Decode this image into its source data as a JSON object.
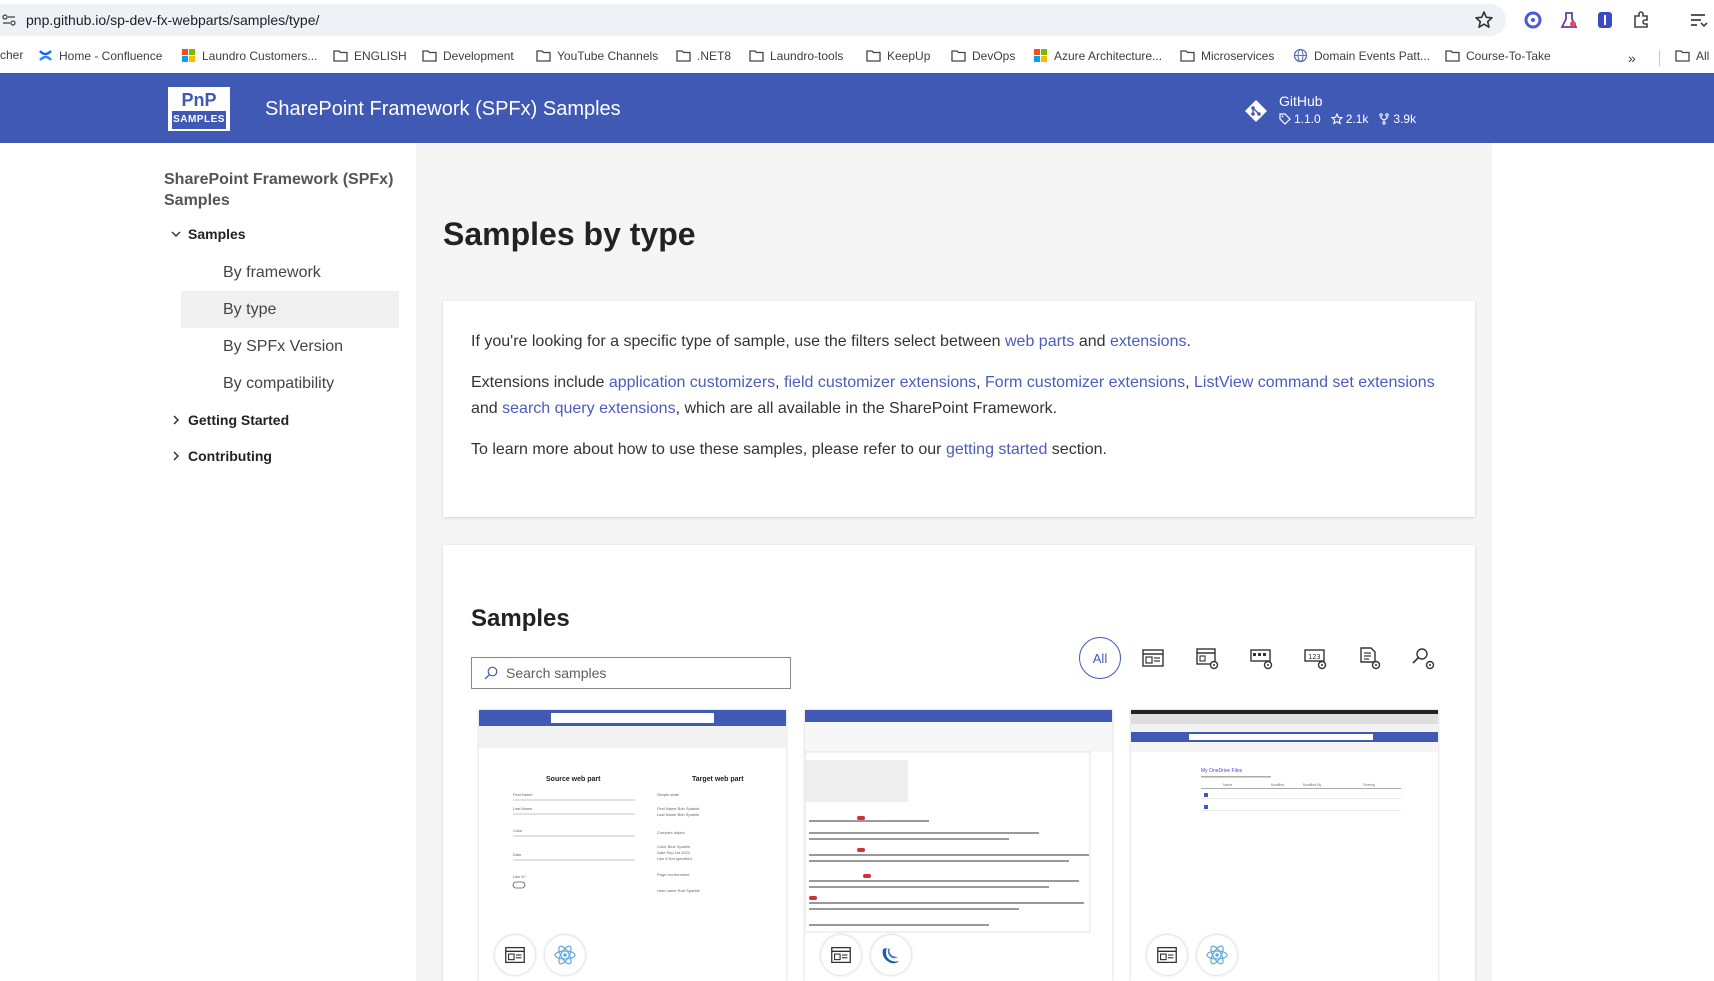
{
  "browser": {
    "url": "pnp.github.io/sp-dev-fx-webparts/samples/type/",
    "bookmarks": [
      {
        "label": "cher",
        "icon": "none"
      },
      {
        "label": "Home - Confluence",
        "icon": "confluence-icon"
      },
      {
        "label": "Laundro Customers...",
        "icon": "microsoft-icon"
      },
      {
        "label": "ENGLISH",
        "icon": "folder-icon"
      },
      {
        "label": "Development",
        "icon": "folder-icon"
      },
      {
        "label": "YouTube Channels",
        "icon": "folder-icon"
      },
      {
        "label": ".NET8",
        "icon": "folder-icon"
      },
      {
        "label": "Laundro-tools",
        "icon": "folder-icon"
      },
      {
        "label": "KeepUp",
        "icon": "folder-icon"
      },
      {
        "label": "DevOps",
        "icon": "folder-icon"
      },
      {
        "label": "Azure Architecture...",
        "icon": "microsoft-icon"
      },
      {
        "label": "Microservices",
        "icon": "folder-icon"
      },
      {
        "label": "Domain Events Patt...",
        "icon": "globe-icon"
      },
      {
        "label": "Course-To-Take",
        "icon": "folder-icon"
      }
    ],
    "more_label": "»",
    "all_bookmarks_label": "All"
  },
  "header": {
    "logo_top": "PnP",
    "logo_bottom": "SAMPLES",
    "title": "SharePoint Framework (SPFx) Samples",
    "github_label": "GitHub",
    "github_version": "1.1.0",
    "github_stars": "2.1k",
    "github_forks": "3.9k",
    "brand_color": "#4059b5"
  },
  "sidebar": {
    "title": "SharePoint Framework (SPFx) Samples",
    "samples_label": "Samples",
    "links": [
      "By framework",
      "By type",
      "By SPFx Version",
      "By compatibility"
    ],
    "active_link": "By type",
    "getting_started_label": "Getting Started",
    "contributing_label": "Contributing"
  },
  "main": {
    "title": "Samples by type",
    "intro": {
      "p1_before": "If you're looking for a specific type of sample, use the filters select between ",
      "p1_link1": "web parts",
      "p1_mid": " and ",
      "p1_link2": "extensions",
      "p1_after": ".",
      "p2_before": "Extensions include ",
      "p2_link1": "application customizers",
      "p2_sep1": ", ",
      "p2_link2": "field customizer extensions",
      "p2_sep2": ", ",
      "p2_link3": "Form customizer extensions",
      "p2_sep3": ", ",
      "p2_link4": "ListView command set extensions",
      "p2_mid": " and ",
      "p2_link5": "search query extensions",
      "p2_after": ", which are all available in the SharePoint Framework.",
      "p3_before": "To learn more about how to use these samples, please refer to our ",
      "p3_link": "getting started",
      "p3_after": " section."
    },
    "samples_heading": "Samples",
    "search_placeholder": "Search samples",
    "filter_all_label": "All",
    "filters": [
      "webpart-icon",
      "application-customizer-icon",
      "command-set-icon",
      "field-customizer-icon",
      "form-customizer-icon",
      "search-query-icon"
    ],
    "cards": [
      {
        "thumb": "Source web part / Target web part form preview",
        "source_label": "Source web part",
        "target_label": "Target web part",
        "type_icon": "webpart-icon",
        "framework_icon": "react-icon"
      },
      {
        "thumb": "Discussion feed preview",
        "type_icon": "webpart-icon",
        "framework_icon": "jquery-icon"
      },
      {
        "thumb": "My OneDrive Files preview",
        "list_title": "My OneDrive Files",
        "type_icon": "webpart-icon",
        "framework_icon": "react-icon"
      }
    ]
  }
}
